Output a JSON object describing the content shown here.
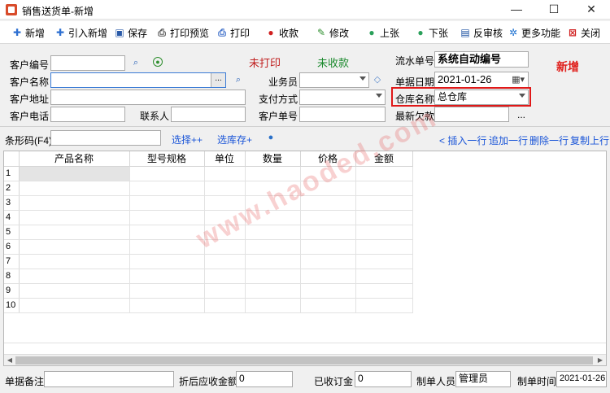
{
  "window": {
    "title": "销售送货单-新增",
    "controls": [
      "—",
      "☐",
      "✕"
    ]
  },
  "toolbar": [
    {
      "label": "新增",
      "icon": "plus-icon",
      "glyph": "✚",
      "color": "#2d6fd1"
    },
    {
      "label": "引入新增",
      "icon": "import-plus-icon",
      "glyph": "✚",
      "color": "#2d6fd1"
    },
    {
      "label": "保存",
      "icon": "save-icon",
      "glyph": "▣",
      "color": "#2a5aa8"
    },
    {
      "label": "打印预览",
      "icon": "print-preview-icon",
      "glyph": "⎙",
      "color": "#555555"
    },
    {
      "label": "打印",
      "icon": "print-icon",
      "glyph": "⎙",
      "color": "#3a6cc8"
    },
    {
      "label": "收款",
      "icon": "payment-icon",
      "glyph": "●",
      "color": "#d02020"
    },
    {
      "label": "修改",
      "icon": "edit-icon",
      "glyph": "✎",
      "color": "#2f8f2f"
    },
    {
      "label": "上张",
      "icon": "previous-icon",
      "glyph": "●",
      "color": "#2aa05a"
    },
    {
      "label": "下张",
      "icon": "next-icon",
      "glyph": "●",
      "color": "#2aa05a"
    },
    {
      "label": "反审核",
      "icon": "unaudit-icon",
      "glyph": "▤",
      "color": "#1a4fa0"
    },
    {
      "label": "更多功能",
      "icon": "more-gear-icon",
      "glyph": "✲",
      "color": "#1a6fd0"
    },
    {
      "label": "关闭",
      "icon": "close-icon",
      "glyph": "⊠",
      "color": "#d02020"
    }
  ],
  "form": {
    "customer_code_label": "客户编号",
    "customer_code_value": "",
    "customer_name_label": "客户名称",
    "customer_name_value": "",
    "customer_address_label": "客户地址",
    "customer_address_value": "",
    "customer_phone_label": "客户电话",
    "customer_phone_value": "",
    "contact_label": "联系人",
    "contact_value": "",
    "salesperson_label": "业务员",
    "salesperson_value": "",
    "payment_method_label": "支付方式",
    "payment_method_value": "",
    "customer_order_label": "客户单号",
    "customer_order_value": "",
    "serial_label": "流水单号",
    "serial_value": "系统自动编号",
    "date_label": "单据日期",
    "date_value": "2021-01-26",
    "warehouse_label": "仓库名称",
    "warehouse_value": "总仓库",
    "latest_debt_label": "最新欠款",
    "latest_debt_value": "",
    "latest_debt_more": "...",
    "print_status": "未打印",
    "payment_status": "未收款",
    "mode": "新增",
    "dot_button": "..."
  },
  "barcode": {
    "label": "条形码(F4)",
    "value": "",
    "select_label": "选择++",
    "select_stock_label": "选库存+"
  },
  "row_actions": {
    "insert": "< 插入一行",
    "append": "追加一行",
    "delete": "删除一行",
    "copy": "复制上行"
  },
  "grid": {
    "columns": [
      "",
      "产品名称",
      "型号规格",
      "单位",
      "数量",
      "价格",
      "金额"
    ],
    "row_numbers": [
      "1",
      "2",
      "3",
      "4",
      "5",
      "6",
      "7",
      "8",
      "9",
      "10"
    ]
  },
  "footer": {
    "remarks_label": "单据备注",
    "remarks_value": "",
    "discount_label": "折后应收金额",
    "discount_value": "0",
    "received_label": "已收订金",
    "received_value": "0",
    "maker_label": "制单人员",
    "maker_value": "管理员",
    "made_time_label": "制单时间",
    "made_time_value": "2021-01-26"
  },
  "watermark": "www.haoded.com"
}
